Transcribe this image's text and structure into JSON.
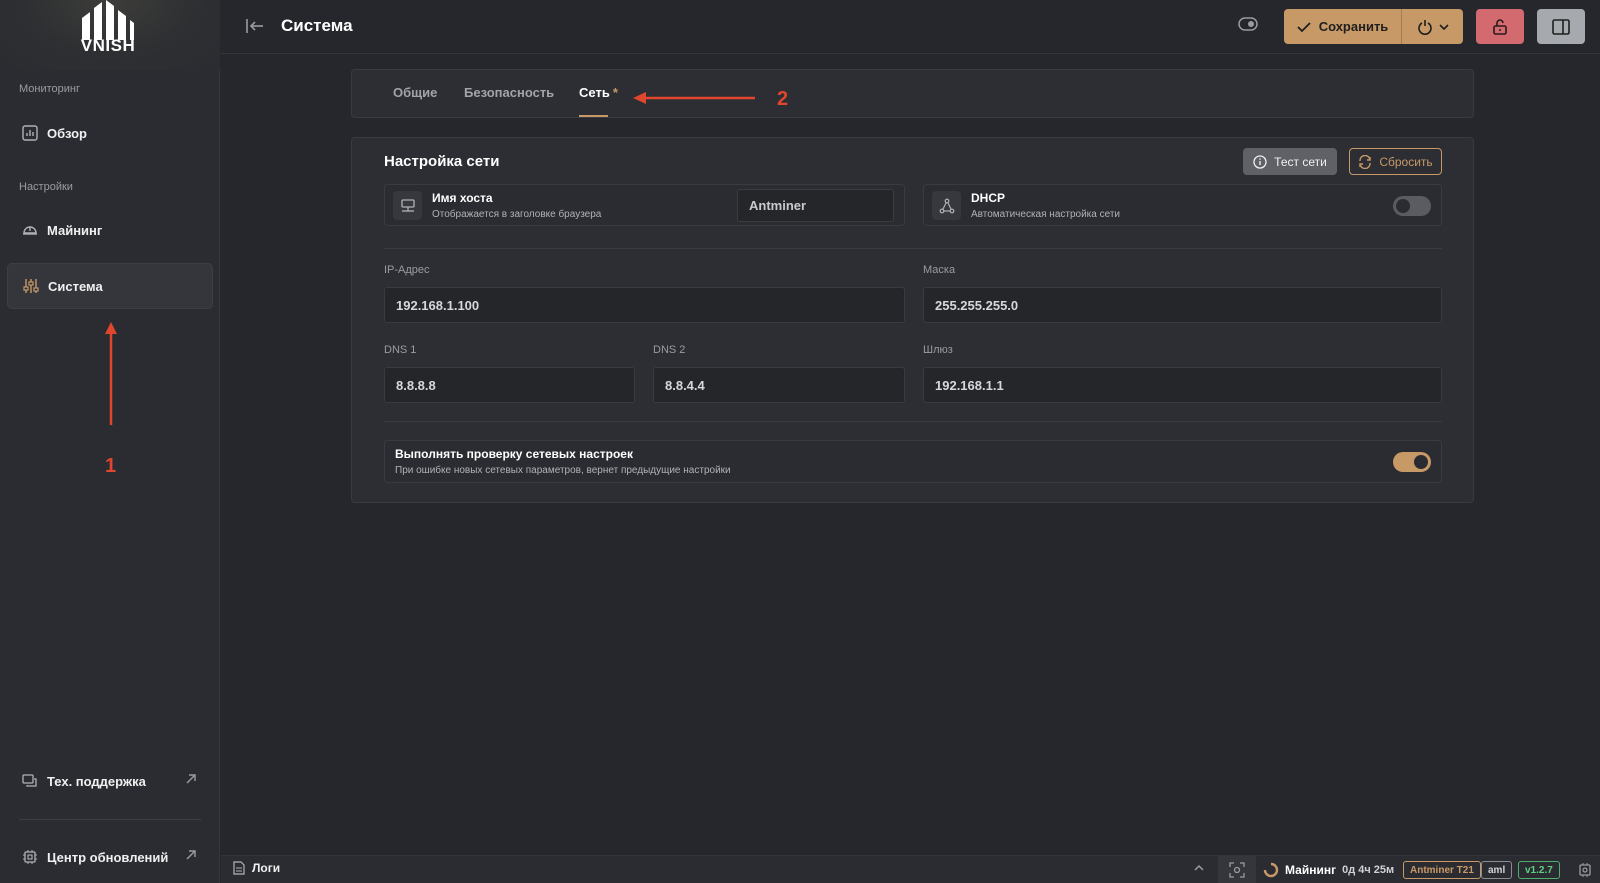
{
  "sidebar": {
    "logo_text": "VNISH",
    "section_monitoring": "Мониторинг",
    "overview": "Обзор",
    "section_settings": "Настройки",
    "mining": "Майнинг",
    "system": "Система",
    "support": "Тех. поддержка",
    "updates": "Центр обновлений"
  },
  "header": {
    "title": "Система",
    "save_label": "Сохранить"
  },
  "tabs": [
    {
      "label": "Общие"
    },
    {
      "label": "Безопасность"
    },
    {
      "label": "Сеть",
      "modified_marker": "*"
    }
  ],
  "network": {
    "title": "Настройка сети",
    "test_button": "Тест сети",
    "reset_button": "Сбросить",
    "hostname": {
      "title": "Имя хоста",
      "subtitle": "Отображается в заголовке браузера",
      "value": "Antminer"
    },
    "dhcp": {
      "title": "DHCP",
      "subtitle": "Автоматическая настройка сети",
      "enabled": false
    },
    "ip_label": "IP-Адрес",
    "ip_value": "192.168.1.100",
    "mask_label": "Маска",
    "mask_value": "255.255.255.0",
    "dns1_label": "DNS 1",
    "dns1_value": "8.8.8.8",
    "dns2_label": "DNS 2",
    "dns2_value": "8.8.4.4",
    "gateway_label": "Шлюз",
    "gateway_value": "192.168.1.1",
    "check": {
      "title": "Выполнять проверку сетевых настроек",
      "subtitle": "При ошибке новых сетевых параметров, вернет предыдущие настройки",
      "enabled": true
    }
  },
  "annotations": {
    "marker_1": "1",
    "marker_2": "2",
    "color": "#e0452e"
  },
  "footer": {
    "logs": "Логи",
    "status": "Майнинг",
    "uptime": "0д 4ч 25м",
    "model": "Antminer T21",
    "firmware": "aml",
    "version": "v1.2.7"
  },
  "colors": {
    "accent": "#c79967",
    "danger": "#d26a6f",
    "success": "#5fd07e",
    "background": "#25272c"
  }
}
